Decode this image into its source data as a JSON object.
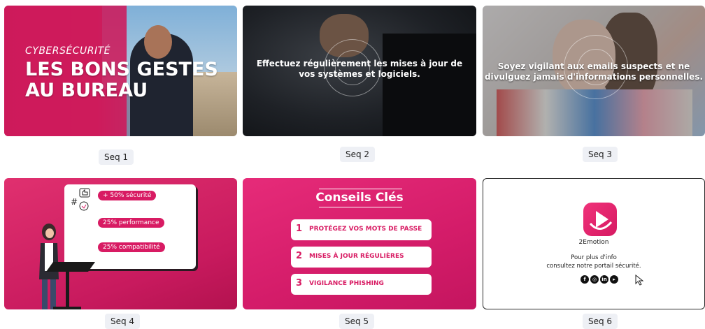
{
  "cards": [
    {
      "seq_label": "Seq 1",
      "kicker": "CYBERSÉCURITÉ",
      "title_line1": "LES BONS GESTES",
      "title_line2": "AU BUREAU"
    },
    {
      "seq_label": "Seq 2",
      "caption_line1": "Effectuez régulièrement les mises à jour de",
      "caption_line2": "vos systèmes et logiciels."
    },
    {
      "seq_label": "Seq 3",
      "caption_line1": "Soyez vigilant aux emails suspects et ne",
      "caption_line2": "divulguez jamais d'informations personnelles."
    },
    {
      "seq_label": "Seq 4",
      "stats": [
        "+ 50% sécurité",
        "25% performance",
        "25% compatibilité"
      ]
    },
    {
      "seq_label": "Seq 5",
      "title": "Conseils Clés",
      "tips": [
        {
          "num": "1",
          "label": "PROTÉGEZ VOS MOTS DE PASSE"
        },
        {
          "num": "2",
          "label": "MISES À JOUR RÉGULIÈRES"
        },
        {
          "num": "3",
          "label": "VIGILANCE PHISHING"
        }
      ]
    },
    {
      "seq_label": "Seq 6",
      "brand": "2Emotion",
      "info_line1": "Pour plus d'info",
      "info_line2": "consultez notre portail sécurité.",
      "socials": [
        "facebook-icon",
        "instagram-icon",
        "linkedin-icon",
        "youtube-icon"
      ]
    }
  ],
  "colors": {
    "brand_pink": "#d81b63",
    "tag_bg": "#eef0f5"
  }
}
